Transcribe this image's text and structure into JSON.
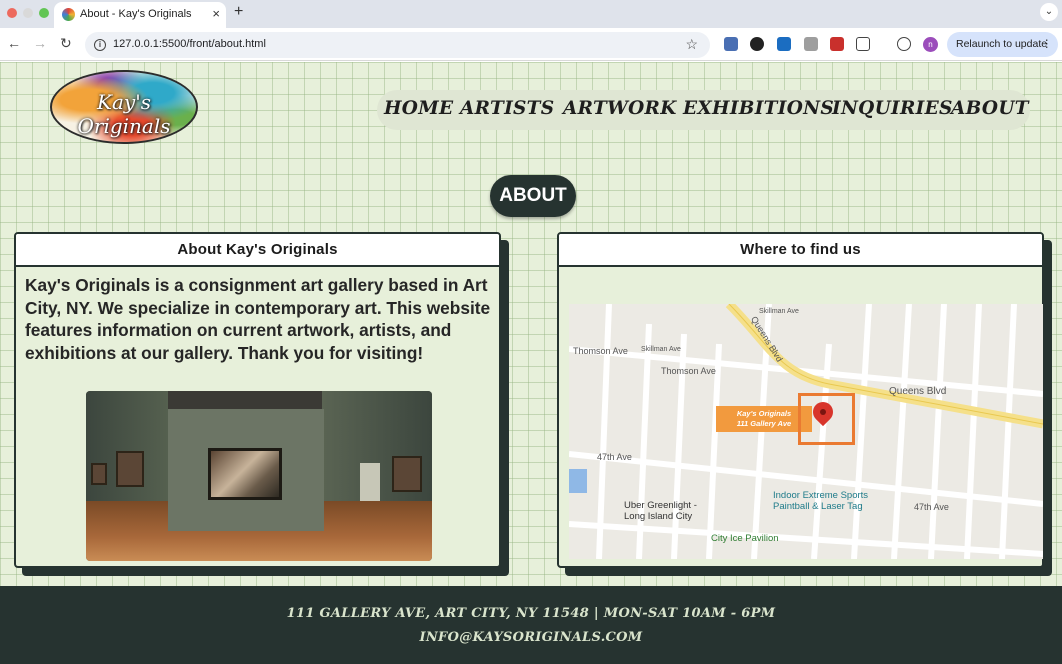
{
  "browser": {
    "tab_title": "About - Kay's Originals",
    "new_tab": "+",
    "tab_close": "×",
    "url": "127.0.0.1:5500/front/about.html",
    "profile_initial": "n",
    "relaunch_label": "Relaunch to update"
  },
  "site": {
    "logo_text": "Kay's Originals",
    "nav": [
      "HOME",
      "ARTISTS",
      "ARTWORK",
      "EXHIBITIONS",
      "INQUIRIES",
      "ABOUT"
    ],
    "page_title": "ABOUT"
  },
  "about_card": {
    "heading": "About Kay's Originals",
    "body": "Kay's Originals is a consignment art gallery based in Art City, NY. We specialize in contemporary art. This website features information on current artwork, artists, and exhibitions at our gallery. Thank you for visiting!"
  },
  "map_card": {
    "heading": "Where to find us",
    "callout_line1": "Kay's Originals",
    "callout_line2": "111 Gallery Ave",
    "streets": [
      "Thomson Ave",
      "Thomson Ave",
      "Queens Blvd",
      "Queens Blvd",
      "47th Ave",
      "47th Ave",
      "Skillman Ave",
      "Skillman Ave"
    ],
    "places": [
      "Uber Greenlight - Long Island City",
      "Indoor Extreme Sports Paintball & Laser Tag",
      "City Ice Pavilion"
    ]
  },
  "footer": {
    "address": "111 Gallery Ave, Art City, NY 11548 | Mon-Sat 10am - 6pm",
    "email": "info@kaysoriginals.com"
  },
  "colors": {
    "dark": "#263330",
    "background": "#e7f0da",
    "accent_orange": "#f29a3e"
  }
}
